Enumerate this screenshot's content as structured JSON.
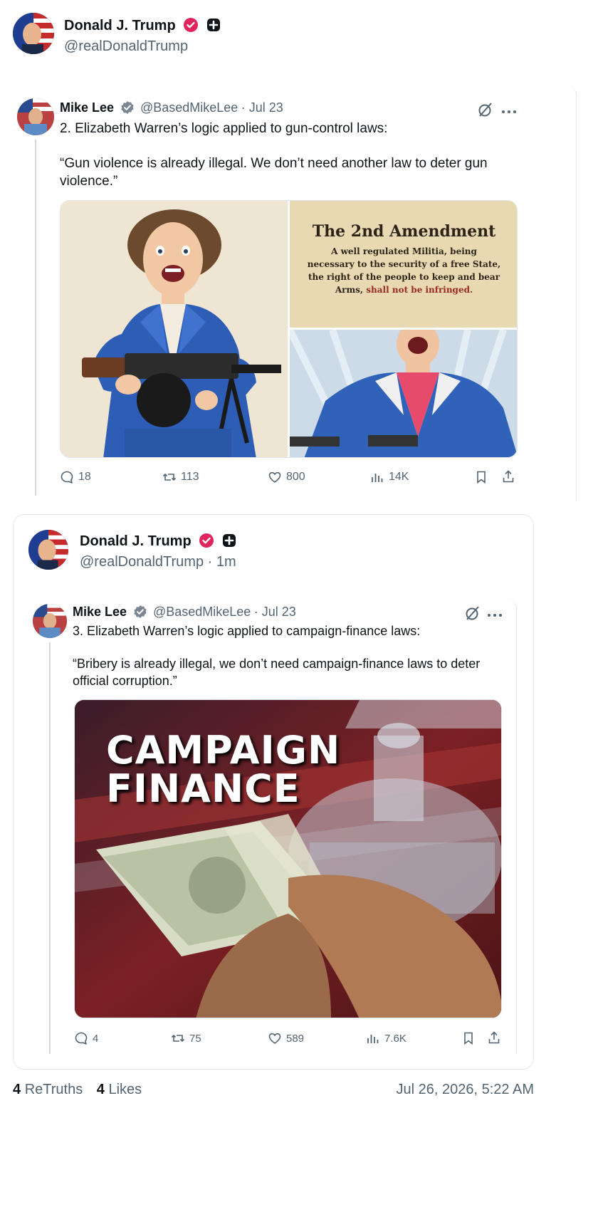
{
  "post": {
    "author_name": "Donald J. Trump",
    "author_handle": "@realDonaldTrump"
  },
  "quote1": {
    "author_name": "Mike Lee",
    "author_handle": "@BasedMikeLee",
    "date": "· Jul 23",
    "text_line1": "2. Elizabeth Warren’s logic applied to gun-control laws:",
    "text_quote": "“Gun violence is already illegal. We don’t need another law to deter gun violence.”",
    "image_right_title": "The 2nd Amendment",
    "image_right_body_1": "A well regulated Militia, being",
    "image_right_body_2": "necessary to the security of a free State,",
    "image_right_body_3": "the right of the people to keep and bear",
    "image_right_body_4a": "Arms, ",
    "image_right_body_4b": "shall not be infringed.",
    "stats": {
      "replies": "18",
      "retweets": "113",
      "likes": "800",
      "views": "14K"
    }
  },
  "repost": {
    "author_name": "Donald J. Trump",
    "author_handle": "@realDonaldTrump",
    "time": "· 1m"
  },
  "quote2": {
    "author_name": "Mike Lee",
    "author_handle": "@BasedMikeLee",
    "date": "· Jul 23",
    "text_line1": "3. Elizabeth Warren’s logic applied to campaign-finance laws:",
    "text_quote": "“Bribery is already illegal, we don’t need campaign-finance laws to deter official corruption.”",
    "image_title_1": "CAMPAIGN",
    "image_title_2": "FINANCE",
    "stats": {
      "replies": "4",
      "retweets": "75",
      "likes": "589",
      "views": "7.6K"
    }
  },
  "footer": {
    "retruths_count": "4",
    "retruths_label": "ReTruths",
    "likes_count": "4",
    "likes_label": "Likes",
    "timestamp": "Jul 26, 2026, 5:22 AM"
  },
  "colors": {
    "verified": "#e0245e",
    "blue_badge": "#657786",
    "text_secondary": "#536471",
    "border": "#e1e8ed"
  }
}
